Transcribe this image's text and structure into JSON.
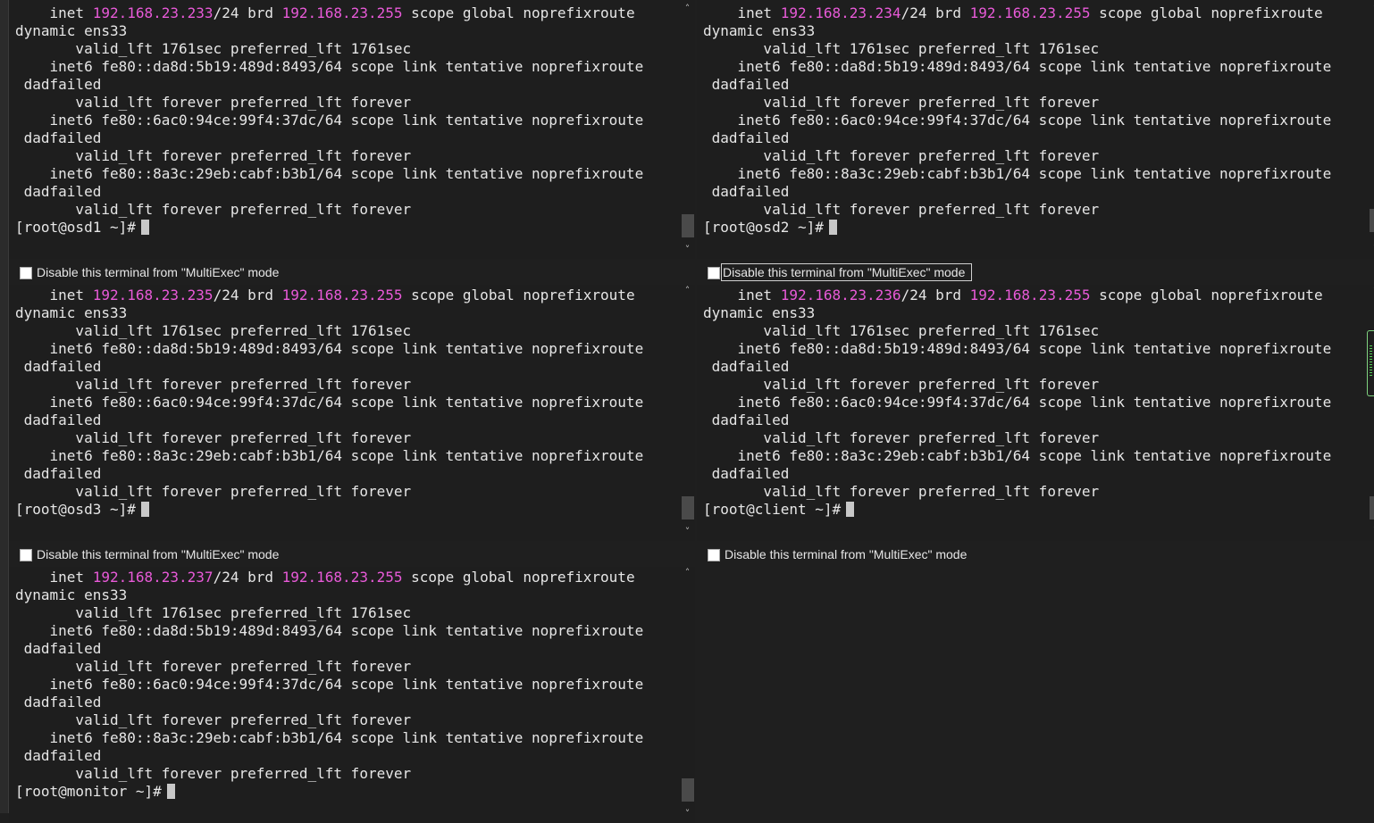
{
  "multiexec_label": "Disable this terminal from \"MultiExec\" mode",
  "terminals": [
    {
      "ip": "192.168.23.233",
      "brd": "192.168.23.255",
      "prompt": "[root@osd1 ~]#"
    },
    {
      "ip": "192.168.23.234",
      "brd": "192.168.23.255",
      "prompt": "[root@osd2 ~]#"
    },
    {
      "ip": "192.168.23.235",
      "brd": "192.168.23.255",
      "prompt": "[root@osd3 ~]#"
    },
    {
      "ip": "192.168.23.236",
      "brd": "192.168.23.255",
      "prompt": "[root@client ~]#"
    },
    {
      "ip": "192.168.23.237",
      "brd": "192.168.23.255",
      "prompt": "[root@monitor ~]#"
    }
  ],
  "common_lines": {
    "inet_prefix": "    inet ",
    "inet_mid": "/24 brd ",
    "inet_suffix": " scope global noprefixroute",
    "dynamic": "dynamic ens33",
    "valid_sec": "       valid_lft 1761sec preferred_lft 1761sec",
    "inet6_1": "    inet6 fe80::da8d:5b19:489d:8493/64 scope link tentative noprefixroute",
    "inet6_2": "    inet6 fe80::6ac0:94ce:99f4:37dc/64 scope link tentative noprefixroute",
    "inet6_3": "    inet6 fe80::8a3c:29eb:cabf:b3b1/64 scope link tentative noprefixroute",
    "dadfailed": " dadfailed",
    "valid_forever": "       valid_lft forever preferred_lft forever"
  },
  "scroll_up": "˄",
  "scroll_down": "˅"
}
